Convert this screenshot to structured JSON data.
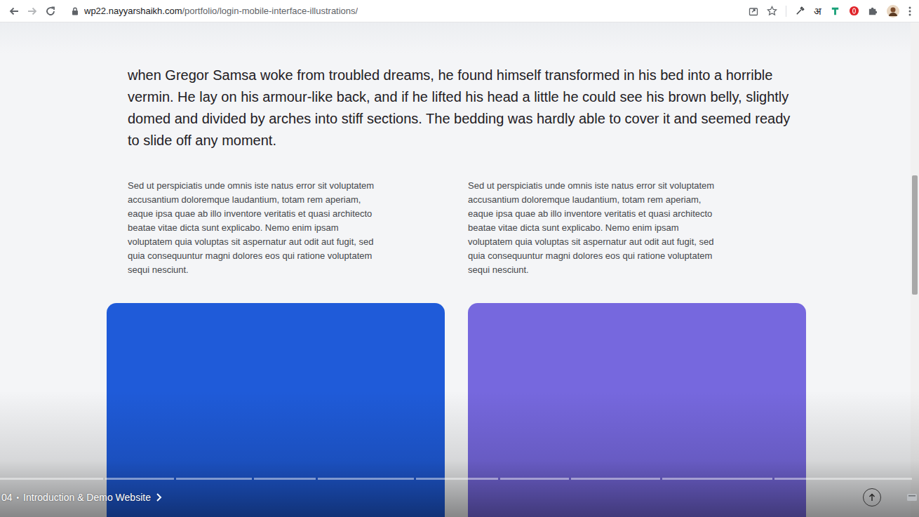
{
  "browser": {
    "url_host": "wp22.nayyarshaikh.com",
    "url_path": "/portfolio/login-mobile-interface-illustrations/",
    "language_button": "अ"
  },
  "article": {
    "lead": "when Gregor Samsa woke from troubled dreams, he found himself transformed in his bed into a horrible vermin. He lay on his armour-like back, and if he lifted his head a little he could see his brown belly, slightly domed and divided by arches into stiff sections. The bedding was hardly able to cover it and seemed ready to slide off any moment.",
    "columns": [
      "Sed ut perspiciatis unde omnis iste natus error sit voluptatem accusantium doloremque laudantium, totam rem aperiam, eaque ipsa quae ab illo inventore veritatis et quasi architecto beatae vitae dicta sunt explicabo. Nemo enim ipsam voluptatem quia voluptas sit aspernatur aut odit aut fugit, sed quia consequuntur magni dolores eos qui ratione voluptatem sequi nesciunt.",
      "Sed ut perspiciatis unde omnis iste natus error sit voluptatem accusantium doloremque laudantium, totam rem aperiam, eaque ipsa quae ab illo inventore veritatis et quasi architecto beatae vitae dicta sunt explicabo. Nemo enim ipsam voluptatem quia voluptas sit aspernatur aut odit aut fugit, sed quia consequuntur magni dolores eos qui ratione voluptatem sequi nesciunt."
    ]
  },
  "gallery": [
    {
      "color": "#1f5bd9"
    },
    {
      "color": "#7668de"
    }
  ],
  "video_player": {
    "chapter_time": "04",
    "separator": "•",
    "chapter_title": "Introduction & Demo Website"
  }
}
